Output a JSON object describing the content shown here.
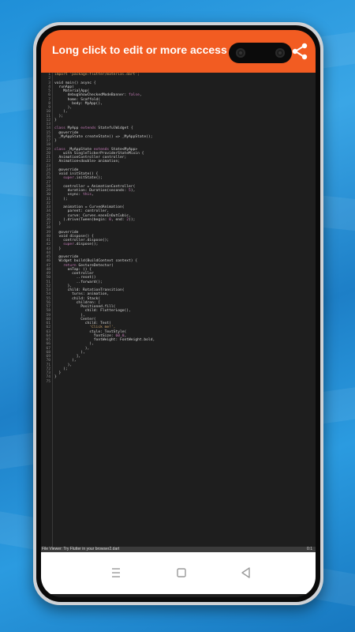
{
  "app": {
    "title": "Long click to edit or more access",
    "accent": "#f25c22"
  },
  "status": {
    "file": "File Viewer: Try Flutter in your browser2.dart",
    "position": "0:1"
  },
  "icons": {
    "share": "share-icon",
    "menu": "nav-menu-icon",
    "home": "nav-home-icon",
    "back": "nav-back-icon"
  },
  "code": [
    [
      {
        "t": "import 'package:flutter/material.dart';",
        "c": "#c9a06a"
      }
    ],
    [],
    [
      {
        "t": "void main() async {",
        "c": "#d7d7d7"
      }
    ],
    [
      {
        "t": "  runApp(",
        "c": "#d7d7d7"
      }
    ],
    [
      {
        "t": "    MaterialApp(",
        "c": "#d7d7d7"
      }
    ],
    [
      {
        "t": "      debugShowCheckedModeBanner: ",
        "c": "#d7d7d7"
      },
      {
        "t": "false",
        "c": "#c77dba"
      },
      {
        "t": ",",
        "c": "#d7d7d7"
      }
    ],
    [
      {
        "t": "      home: Scaffold(",
        "c": "#d7d7d7"
      }
    ],
    [
      {
        "t": "        body: MyApp(),",
        "c": "#d7d7d7"
      }
    ],
    [
      {
        "t": "      ),",
        "c": "#d7d7d7"
      }
    ],
    [
      {
        "t": "    ),",
        "c": "#d7d7d7"
      }
    ],
    [
      {
        "t": "  );",
        "c": "#d7d7d7"
      }
    ],
    [
      {
        "t": "}",
        "c": "#d7d7d7"
      }
    ],
    [],
    [
      {
        "t": "class",
        "c": "#c77dba"
      },
      {
        "t": " MyApp ",
        "c": "#d7d7d7"
      },
      {
        "t": "extends",
        "c": "#c77dba"
      },
      {
        "t": " StatefulWidget {",
        "c": "#d7d7d7"
      }
    ],
    [
      {
        "t": "  @override",
        "c": "#d7d7d7"
      }
    ],
    [
      {
        "t": "  _MyAppState createState() => _MyAppState();",
        "c": "#d7d7d7"
      }
    ],
    [
      {
        "t": "}",
        "c": "#d7d7d7"
      }
    ],
    [],
    [
      {
        "t": "class",
        "c": "#c77dba"
      },
      {
        "t": " _MyAppState ",
        "c": "#d7d7d7"
      },
      {
        "t": "extends",
        "c": "#c77dba"
      },
      {
        "t": " State<MyApp>",
        "c": "#d7d7d7"
      }
    ],
    [
      {
        "t": "    with SingleTickerProviderStateMixin {",
        "c": "#d7d7d7"
      }
    ],
    [
      {
        "t": "  AnimationController controller;",
        "c": "#d7d7d7"
      }
    ],
    [
      {
        "t": "  Animation<double> animation;",
        "c": "#d7d7d7"
      }
    ],
    [],
    [
      {
        "t": "  @override",
        "c": "#d7d7d7"
      }
    ],
    [
      {
        "t": "  void initState() {",
        "c": "#d7d7d7"
      }
    ],
    [
      {
        "t": "    ",
        "c": "#d7d7d7"
      },
      {
        "t": "super",
        "c": "#c77dba"
      },
      {
        "t": ".initState();",
        "c": "#d7d7d7"
      }
    ],
    [],
    [
      {
        "t": "    controller = AnimationController(",
        "c": "#d7d7d7"
      }
    ],
    [
      {
        "t": "      duration: Duration(seconds: ",
        "c": "#d7d7d7"
      },
      {
        "t": "5",
        "c": "#c77dba"
      },
      {
        "t": "),",
        "c": "#d7d7d7"
      }
    ],
    [
      {
        "t": "      vsync: ",
        "c": "#d7d7d7"
      },
      {
        "t": "this",
        "c": "#c77dba"
      },
      {
        "t": ",",
        "c": "#d7d7d7"
      }
    ],
    [
      {
        "t": "    );",
        "c": "#d7d7d7"
      }
    ],
    [],
    [
      {
        "t": "    animation = CurvedAnimation(",
        "c": "#d7d7d7"
      }
    ],
    [
      {
        "t": "      parent: controller,",
        "c": "#d7d7d7"
      }
    ],
    [
      {
        "t": "      curve: Curves.easeInOutCubic,",
        "c": "#d7d7d7"
      }
    ],
    [
      {
        "t": "    ).drive(Tween(begin: ",
        "c": "#d7d7d7"
      },
      {
        "t": "0",
        "c": "#c77dba"
      },
      {
        "t": ", end: ",
        "c": "#d7d7d7"
      },
      {
        "t": "2",
        "c": "#c77dba"
      },
      {
        "t": "));",
        "c": "#d7d7d7"
      }
    ],
    [
      {
        "t": "  }",
        "c": "#d7d7d7"
      }
    ],
    [],
    [
      {
        "t": "  @override",
        "c": "#d7d7d7"
      }
    ],
    [
      {
        "t": "  void dispose() {",
        "c": "#d7d7d7"
      }
    ],
    [
      {
        "t": "    controller.dispose();",
        "c": "#d7d7d7"
      }
    ],
    [
      {
        "t": "    ",
        "c": "#d7d7d7"
      },
      {
        "t": "super",
        "c": "#c77dba"
      },
      {
        "t": ".dispose();",
        "c": "#d7d7d7"
      }
    ],
    [
      {
        "t": "  }",
        "c": "#d7d7d7"
      }
    ],
    [],
    [
      {
        "t": "  @override",
        "c": "#d7d7d7"
      }
    ],
    [
      {
        "t": "  Widget build(BuildContext context) {",
        "c": "#d7d7d7"
      }
    ],
    [
      {
        "t": "    ",
        "c": "#d7d7d7"
      },
      {
        "t": "return",
        "c": "#c77dba"
      },
      {
        "t": " GestureDetector(",
        "c": "#d7d7d7"
      }
    ],
    [
      {
        "t": "      onTap: () {",
        "c": "#d7d7d7"
      }
    ],
    [
      {
        "t": "        controller",
        "c": "#d7d7d7"
      }
    ],
    [
      {
        "t": "          ..reset()",
        "c": "#d7d7d7"
      }
    ],
    [
      {
        "t": "          ..forward();",
        "c": "#d7d7d7"
      }
    ],
    [
      {
        "t": "      },",
        "c": "#d7d7d7"
      }
    ],
    [
      {
        "t": "      child: RotationTransition(",
        "c": "#d7d7d7"
      }
    ],
    [
      {
        "t": "        turns: animation,",
        "c": "#d7d7d7"
      }
    ],
    [
      {
        "t": "        child: Stack(",
        "c": "#d7d7d7"
      }
    ],
    [
      {
        "t": "          children: [",
        "c": "#d7d7d7"
      }
    ],
    [
      {
        "t": "            Positioned.fill(",
        "c": "#d7d7d7"
      }
    ],
    [
      {
        "t": "              child: FlutterLogo(),",
        "c": "#d7d7d7"
      }
    ],
    [
      {
        "t": "            ),",
        "c": "#d7d7d7"
      }
    ],
    [
      {
        "t": "            Center(",
        "c": "#d7d7d7"
      }
    ],
    [
      {
        "t": "              child: Text(",
        "c": "#d7d7d7"
      }
    ],
    [
      {
        "t": "                'Click me!',",
        "c": "#c9a06a"
      }
    ],
    [
      {
        "t": "                style: TextStyle(",
        "c": "#d7d7d7"
      }
    ],
    [
      {
        "t": "                  fontSize: ",
        "c": "#d7d7d7"
      },
      {
        "t": "60.0",
        "c": "#c77dba"
      },
      {
        "t": ",",
        "c": "#d7d7d7"
      }
    ],
    [
      {
        "t": "                  fontWeight: FontWeight.bold,",
        "c": "#d7d7d7"
      }
    ],
    [
      {
        "t": "                ),",
        "c": "#d7d7d7"
      }
    ],
    [
      {
        "t": "              ),",
        "c": "#d7d7d7"
      }
    ],
    [
      {
        "t": "            ),",
        "c": "#d7d7d7"
      }
    ],
    [
      {
        "t": "          ],",
        "c": "#d7d7d7"
      }
    ],
    [
      {
        "t": "        ),",
        "c": "#d7d7d7"
      }
    ],
    [
      {
        "t": "      ),",
        "c": "#d7d7d7"
      }
    ],
    [
      {
        "t": "    );",
        "c": "#d7d7d7"
      }
    ],
    [
      {
        "t": "  }",
        "c": "#d7d7d7"
      }
    ],
    [
      {
        "t": "}",
        "c": "#d7d7d7"
      }
    ],
    []
  ]
}
